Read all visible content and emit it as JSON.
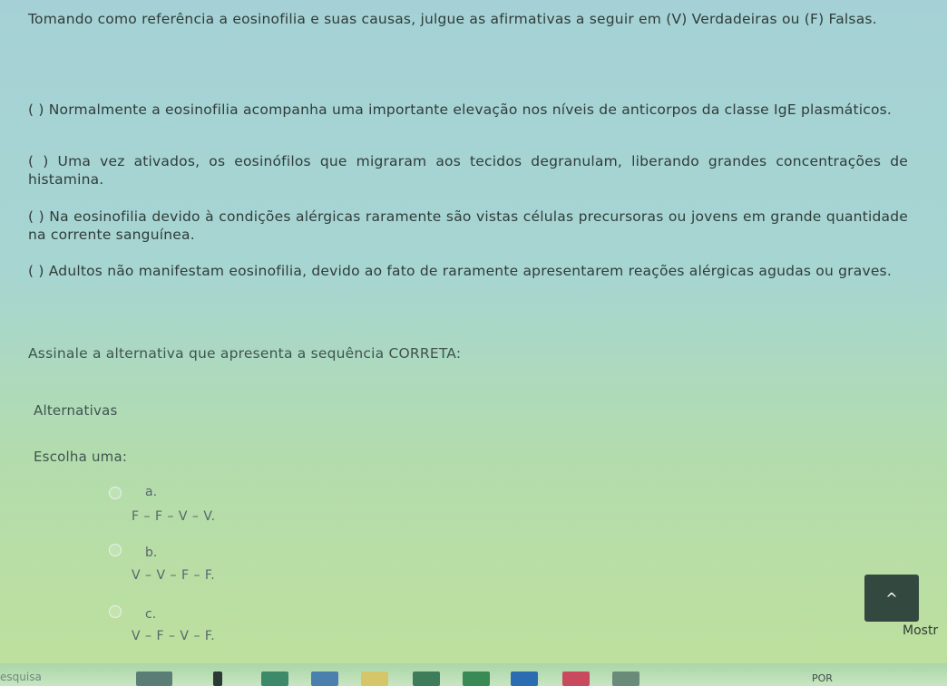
{
  "question": {
    "intro": "Tomando como referência a eosinofilia e suas causas, julgue as afirmativas a seguir em (V) Verdadeiras ou (F) Falsas.",
    "statements": [
      "(    ) Normalmente a eosinofilia acompanha uma importante elevação nos níveis de anticorpos da classe IgE plasmáticos.",
      "(   ) Uma vez ativados, os eosinófilos que migraram aos tecidos degranulam, liberando grandes concentrações de histamina.",
      "(    ) Na eosinofilia devido à condições alérgicas raramente são vistas células precursoras ou jovens em grande quantidade na corrente sanguínea.",
      "(   ) Adultos não manifestam eosinofilia, devido ao fato de raramente apresentarem reações alérgicas agudas ou graves."
    ],
    "prompt": "Assinale a alternativa que apresenta a sequência CORRETA:"
  },
  "labels": {
    "alternativas": "Alternativas",
    "escolha": "Escolha uma:"
  },
  "options": [
    {
      "letter": "a.",
      "value": "F – F – V – V."
    },
    {
      "letter": "b.",
      "value": "V – V – F – F."
    },
    {
      "letter": "c.",
      "value": "V – F – V – F."
    }
  ],
  "ui": {
    "scroll_top_icon": "^",
    "mostrar_fragment": "Mostr",
    "search_placeholder": "esquisa",
    "tray_text": "POR"
  }
}
